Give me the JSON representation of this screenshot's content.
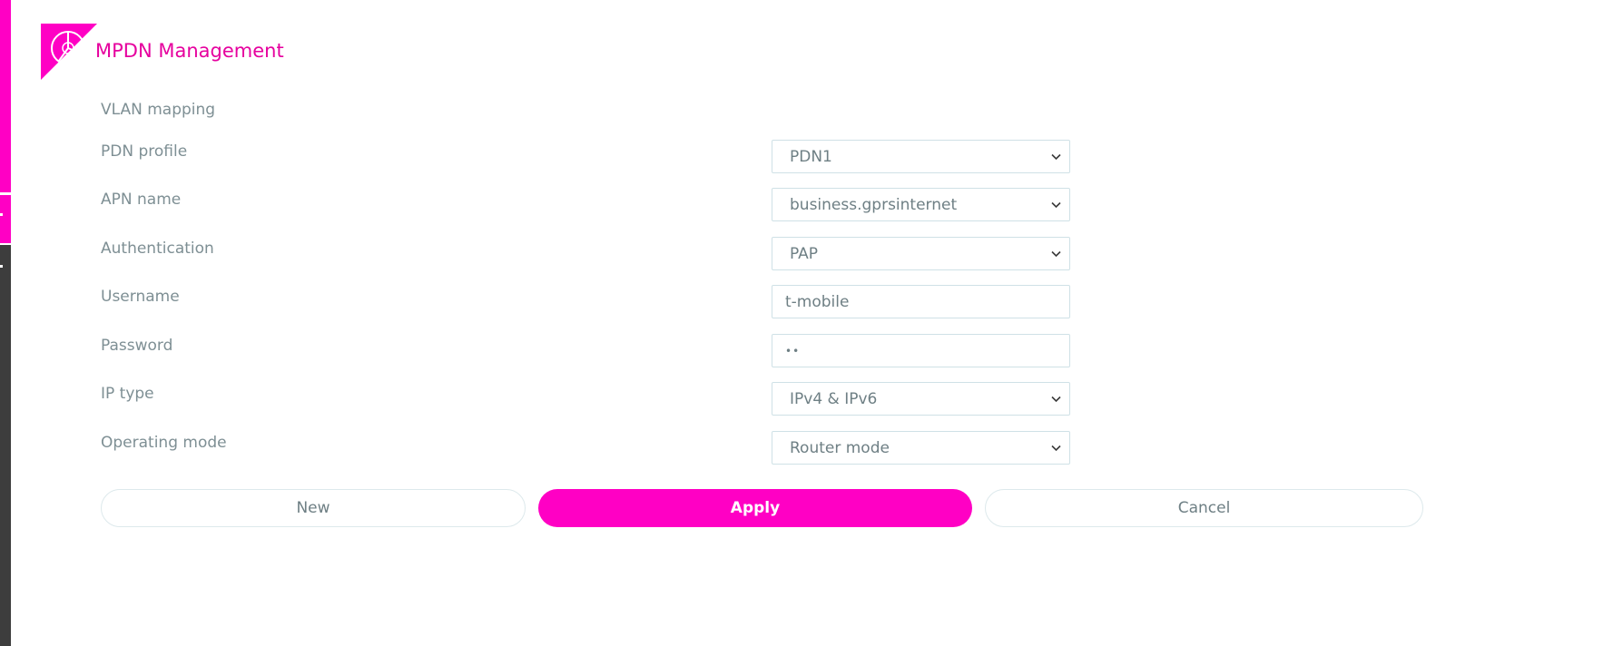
{
  "header": {
    "title": "MPDN Management",
    "logo_icon": "pie-chart-icon"
  },
  "colors": {
    "brand": "#ff00c4",
    "title": "#e6009e",
    "sidebar_dark": "#3d3d3d"
  },
  "form": {
    "section_label": "VLAN mapping",
    "fields": {
      "pdn_profile": {
        "label": "PDN profile",
        "value": "PDN1"
      },
      "apn_name": {
        "label": "APN name",
        "value": "business.gprsinternet"
      },
      "authentication": {
        "label": "Authentication",
        "value": "PAP"
      },
      "username": {
        "label": "Username",
        "value": "t-mobile"
      },
      "password": {
        "label": "Password",
        "value": "••"
      },
      "ip_type": {
        "label": "IP type",
        "value": "IPv4 & IPv6"
      },
      "operating_mode": {
        "label": "Operating mode",
        "value": "Router mode"
      }
    }
  },
  "actions": {
    "new_label": "New",
    "apply_label": "Apply",
    "cancel_label": "Cancel"
  }
}
